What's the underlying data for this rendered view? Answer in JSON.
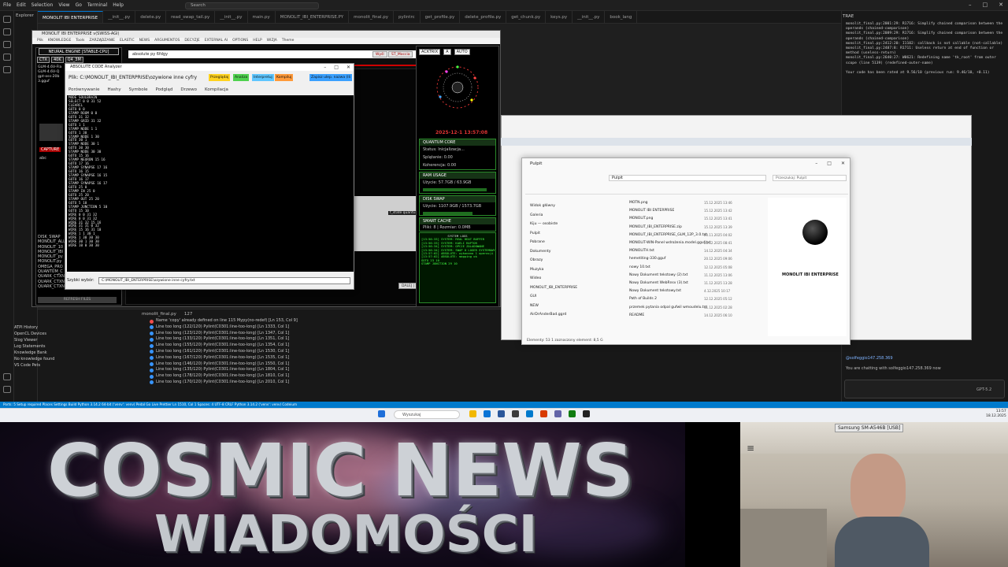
{
  "vscode": {
    "menu": [
      "File",
      "Edit",
      "Selection",
      "View",
      "Go",
      "Terminal",
      "Help"
    ],
    "search": "Search",
    "explorer_title": "Explorer",
    "tabs": [
      {
        "label": "MONOLIT IBI ENTERPRISE",
        "active": true
      },
      {
        "label": "__init__.py"
      },
      {
        "label": "delete.py"
      },
      {
        "label": "read_swap_tail.py"
      },
      {
        "label": "__init__.py"
      },
      {
        "label": "main.py"
      },
      {
        "label": "MONOLIT_IBI_ENTERPRISE.PY"
      },
      {
        "label": "monolit_final.py"
      },
      {
        "label": "pylintrc"
      },
      {
        "label": "get_profile.py"
      },
      {
        "label": "delete_profile.py"
      },
      {
        "label": "get_chunk.py"
      },
      {
        "label": "keys.py"
      },
      {
        "label": "__init__.py"
      },
      {
        "label": "book_lang"
      }
    ],
    "left_tree": [
      "DISK_SWAP",
      "MONOLIT_ALL",
      "MONOLIT_10",
      "MONOLIT_IBI",
      "MONOLIT_py",
      "MONOLIT.py",
      "OMEGA_PRO",
      "QUANTUM_C",
      "QUARK_CTXN",
      "QUARK_CTXN",
      "QUARK_CTXN"
    ],
    "left_models": [
      "GLM-4.6V-Fla",
      "GLM-4.6V-Q",
      "gpt-oss-20b",
      "3.gguf"
    ],
    "sidebar_lower": [
      "ATPI History",
      "OpenCL Devices",
      "Slog Viewer",
      "Log Statements",
      "Knowledge Bank",
      "No knowledge found",
      "VS Code Pets"
    ],
    "bottom_tabs": [
      "monolit_final.py",
      "127"
    ],
    "problems": [
      {
        "text": "Name 'copy' already defined on line 115  Mypy(no-redef)  [Ln 153, Col 9]",
        "error": true
      },
      {
        "text": "Line too long (122/120)  Pylint(C0301:line-too-long)  [Ln 1333, Col 1]"
      },
      {
        "text": "Line too long (123/120)  Pylint(C0301:line-too-long)  [Ln 1347, Col 1]"
      },
      {
        "text": "Line too long (133/120)  Pylint(C0301:line-too-long)  [Ln 1351, Col 1]"
      },
      {
        "text": "Line too long (155/120)  Pylint(C0301:line-too-long)  [Ln 1354, Col 1]"
      },
      {
        "text": "Line too long (161/120)  Pylint(C0301:line-too-long)  [Ln 1530, Col 1]"
      },
      {
        "text": "Line too long (167/120)  Pylint(C0301:line-too-long)  [Ln 1535, Col 1]"
      },
      {
        "text": "Line too long (146/120)  Pylint(C0301:line-too-long)  [Ln 1550, Col 1]"
      },
      {
        "text": "Line too long (135/120)  Pylint(C0301:line-too-long)  [Ln 1804, Col 1]"
      },
      {
        "text": "Line too long (178/120)  Pylint(C0301:line-too-long)  [Ln 1810, Col 1]"
      },
      {
        "text": "Line too long (170/120)  Pylint(C0301:line-too-long)  [Ln 2010, Col 1]"
      }
    ],
    "statusbar": "Ports: 5  Setup required  Places Settings  Build  Python 3.14.2 64-bit ('venv': venv)  Pedal  Go Live  Prettier  Ln 1510, Col 1  Spaces: 4  UTF-8  CRLF  Python 3.14.2 ('venv': venv)  Codeium"
  },
  "neural": {
    "window_title": "MONOLIT IBI ENTERPRISE v(SWISS-AGI)",
    "menu": [
      "Plik",
      "KNOWLEDGE",
      "Tools",
      "ZARZĄDZANIE",
      "ELASTIC",
      "NEWS",
      "ARGUMENTOS",
      "DECYZJE",
      "EXTERNAL AI",
      "OPTIONS",
      "HELP",
      "WIZJA",
      "Theme"
    ],
    "header": "NEURAL ENGINE [STABLE-CPU]",
    "ctx": [
      "CTX",
      "40K",
      "Q4_3M"
    ],
    "input_text": "absolute py 6fdgy",
    "btn1": "Wyśl",
    "btn2": "ST_Moccia",
    "state_label": "f_state quantum sta",
    "dalej": "DALEJ",
    "senc": "SENC",
    "refresh": "REFRESH FILES",
    "capture": "CAPTURE",
    "abc": "abc"
  },
  "analyzer": {
    "title": "ABSOLUTE CODE Analyzer",
    "file_label": "Plik:",
    "file_path": "C:\\MONOLIT_IBI_ENTERPRISE\\ozywione inne cyfry",
    "chips": [
      {
        "label": "Przeglądaj",
        "color": "#ffd21f"
      },
      {
        "label": "Analiza",
        "color": "#4fd14f"
      },
      {
        "label": "Interpretuj",
        "color": "#5ec6ff"
      },
      {
        "label": "Kompiluj",
        "color": "#ff9a3a"
      },
      {
        "label": "Zapisz ulep. nazwa (Ili",
        "color": "#3aa0ff"
      }
    ],
    "tabs": [
      "Porównywanie",
      "Hashy",
      "Symbole",
      "Podgląd",
      "Drzewo",
      "Kompilacja"
    ],
    "code": "MODE SOULBRAIN\nSELECT 0 0 31 52\nCLEARCL\nGOTO 0 0\nSTAMP ROOM 0 0\nGOTO 31 32\nSTAMP GRID 31 32\nGOTO 1 1\nSTAMP NODE 1 1\nGOTO 1 30\nSTAMP NODE 1 30\nGOTO 30 1\nSTAMP NODE 30 1\nGOTO 30 30\nSTAMP NODE 30 30\nGOTO 15 16\nSTAMP NEURON 15 16\nGOTO 17 16\nSTAMP SYNAPSE 17 16\nGOTO 16 15\nSTAMP SYNAPSE 16 15\nGOTO 16 17\nSTAMP SYNAPSE 16 17\nGOTO 25 0\nSTAMP IN 25 0\nGOTO 25 20\nSTAMP OUT 25 20\nGOTO 5 10\nSTAMP JUNCTION 5 10\nGOTO 15 10\nWIRE 0 0 31 32\nWIRE 0 0 31 32\nWIRE 31 32 15 16\nWIRE 31 31 0 32\nWIRE 15 16 31 10\nWIRE 1 1 30 1\nWIRE 1 30 30 30\nWIRE 30 1 30 30\nWIRE 10 0 30 30",
    "save_label": "Szybki wybór:",
    "save_path": "C:\\MONOLIT_IBI_ENTERPRISE\\ozywione inne cyfry.txt"
  },
  "quantum": {
    "top_buttons": [
      "ACKTRIX",
      "A",
      "AUTO"
    ],
    "clock": "2025-12-1 13:57:08",
    "core_title": "QUANTUM CORE",
    "core_status": "Status: Inicjalizacja...",
    "core_splatanie": "Splątanie: 0.00",
    "core_koherencja": "Koherencja: 0.00",
    "ram_title": "RAM USAGE",
    "ram_text": "Użycie: 57.7GB / 63.9GB",
    "ram_level": 0.9,
    "swap_title": "DISK SWAP",
    "swap_text": "Użycie: 1107.9GB / 1573.7GB",
    "swap_level": 0.7,
    "cache_title": "SMART CACHE",
    "cache_text": "Pliki: 8 | Rozmiar: 0.0MB",
    "log_title": "SYSTEM LOGS",
    "log": "[13:56:33] SYSTEM: REAL HEAT BUFFER\n[13:56:33] SYSTEM: KAELI RAPTOR\n[13:56:34] SYSTEM: OPCJE ZALADOWANE\n[13:56:34] SYSTEM: SWAP 0 LOGER SYSTEMOWY\n[13:57:02] ABSOLUTE: wykonano 1 operacji\n[13:57:02] ABSOLUTE: mapping ok\nGOTO 23 10\nSTAMP JUNCTION 29 10"
  },
  "chat": {
    "header": "TRAE",
    "text": "monolit_final.py:2001:29: R1716: Simplify chained comparison between the operands (chained-comparison)\nmonolit_final.py:2089:29: R1716: Simplify chained comparison between the operands (chained-comparison)\nmonolit_final.py:2412:20: I1102: callback is not callable (not-callable)\nmonolit_final.py:2487:8: R1711: Useless return at end of function or method (useless-return)\nmonolit_final.py:2640:27: W0621: Redefining name 'tk_root' from outer scope (line 5139) (redefined-outer-name)\n\nYour code has been rated at 9.56/10 (previous run: 9.46/10, +0.11)",
    "user": "@solfeggio147.258.369",
    "reply": "You are chatting with solfeggio147.258.369 now",
    "model": "GPT-5.2"
  },
  "dialog": {
    "title": "Pulpit",
    "address": "Pulpit",
    "search": "Przeszukaj: Pulpit",
    "nav": [
      "Widok główny",
      "Galeria",
      "Kiju — osobiste",
      "Pulpit",
      "Pobrane",
      "Dokumenty",
      "Obrazy",
      "Muzyka",
      "Wideo",
      "MONOLIT_IBI_ENTERPRISE",
      "GUI",
      "NEW",
      "AirDrAnderBad.ggrd"
    ],
    "files": [
      "MOTN.png",
      "MONOLIT IBI ENTERPRISE",
      "MONOLIT.png",
      "MONOLIT_IBI_ENTERPRISE.zip",
      "MONOLIT_IBI_ENTERPRISE_GLM_12P_3.0.txt",
      "MONOLIT-WIN-Panel wdrożenia.model.gguf.txt",
      "MONOLITH.txt",
      "hemetiting-330.gguf",
      "nowy 10.txt",
      "Nowy Dokument tekstowy (2).txt",
      "Nowy Dokument WebRnsv (3).txt",
      "Nowy Dokument tekstowy.txt",
      "Path of Builds 2",
      "przemek pytania odpal gufwil wmoudelu.txt",
      "README"
    ],
    "dates": [
      "15.12.2025 13:46",
      "15.12.2025 13:42",
      "15.12.2025 13:41",
      "15.12.2025 13:39",
      "20.11.2025 04:02",
      "20.12.2025 08:41",
      "14.12.2025 04:34",
      "20.12.2025 09:06",
      "12.12.2025 05:08",
      "11.12.2025 13:06",
      "11.12.2025 13:28",
      "4.12.2025 10:17",
      "12.12.2025 05:12",
      "11.12.2025 02:28",
      "14.12.2025 06:10"
    ],
    "detail_name": "MONOLIT IBI ENTERPRISE",
    "bottom": "Elementy: 53    1 zaznaczony element: 8,5 G"
  },
  "taskbar": {
    "search": "Wyszukaj",
    "time": "13:57",
    "date": "18.12.2025"
  },
  "banner": {
    "title": "COSMIC NEWS",
    "subtitle": "WIADOMOŚCI"
  },
  "webcam": {
    "label": "Samsung SM-A546B [USB]"
  }
}
